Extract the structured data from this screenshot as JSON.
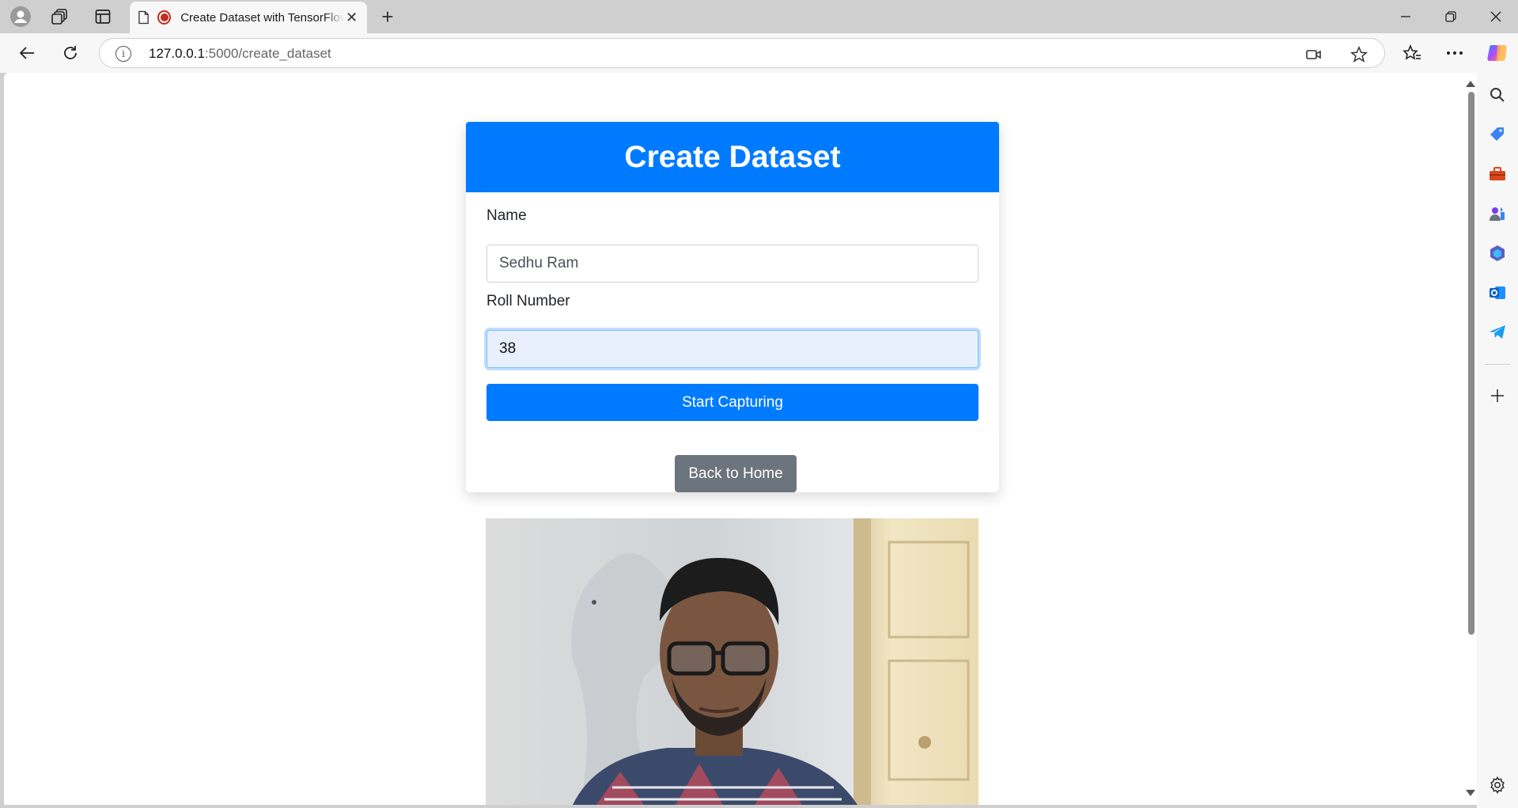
{
  "browser": {
    "tab_title": "Create Dataset with TensorFlow",
    "url_host": "127.0.0.1",
    "url_path": ":5000/create_dataset"
  },
  "page": {
    "header": "Create Dataset",
    "name_label": "Name",
    "name_value": "Sedhu Ram",
    "roll_label": "Roll Number",
    "roll_value": "38",
    "capture_button": "Start Capturing",
    "home_button": "Back to Home"
  },
  "colors": {
    "primary": "#007bff",
    "secondary": "#6c757d"
  },
  "icons": {
    "tabbar": [
      "profile-icon",
      "workspaces-icon",
      "vertical-tabs-icon",
      "page-icon",
      "recording-icon",
      "close-icon",
      "new-tab-icon"
    ],
    "window": [
      "minimize-icon",
      "restore-icon",
      "close-window-icon"
    ],
    "addressbar": [
      "back-icon",
      "refresh-icon",
      "site-info-icon",
      "camera-in-use-icon",
      "favorite-star-icon",
      "favorites-icon",
      "more-icon",
      "copilot-icon"
    ],
    "sidebar": [
      "search-icon",
      "shopping-icon",
      "tools-icon",
      "games-icon",
      "microsoft365-icon",
      "outlook-icon",
      "telegram-icon",
      "add-icon",
      "settings-icon"
    ]
  }
}
